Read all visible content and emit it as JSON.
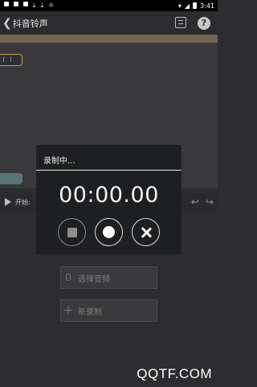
{
  "status_bar": {
    "time": "3:41",
    "left_icons": [
      "notification-icon",
      "notification-icon",
      "notification-icon",
      "download-icon",
      "download-icon",
      "sun-icon"
    ],
    "right_icons": [
      "wifi-icon",
      "signal-icon",
      "battery-icon"
    ]
  },
  "app_bar": {
    "title": "抖音铃声",
    "actions": [
      "list-icon",
      "help-icon"
    ],
    "help_glyph": "?"
  },
  "play_row": {
    "start_label": "开始:",
    "undo_glyph": "↩",
    "redo_glyph": "↪"
  },
  "buttons": {
    "select_audio": "选择音频",
    "new_record": "新录制"
  },
  "dialog": {
    "title": "录制中...",
    "timer": "00:00.00",
    "controls": [
      "stop-icon",
      "record-icon",
      "cancel-icon"
    ]
  },
  "watermark": "QQTF.COM",
  "colors": {
    "background": "#2d2d30",
    "dialog_bg": "#1e1f21",
    "ruler": "#6e6553",
    "marker_border": "#c6a64a"
  }
}
